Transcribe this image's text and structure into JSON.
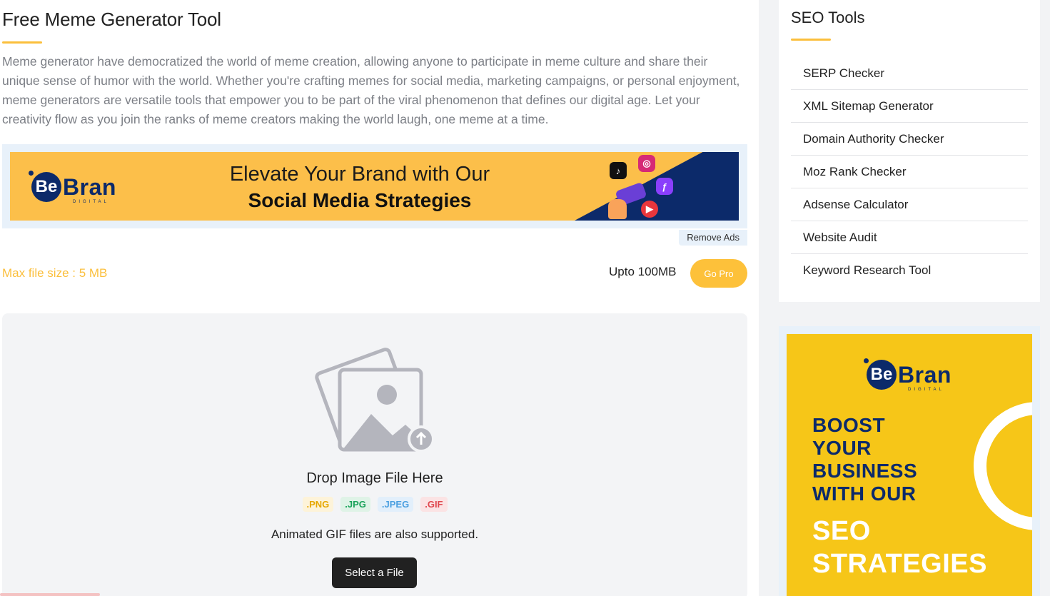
{
  "page": {
    "title": "Free Meme Generator Tool",
    "intro": "Meme generator have democratized the world of meme creation, allowing anyone to participate in meme culture and share their unique sense of humor with the world. Whether you're crafting memes for social media, marketing campaigns, or personal enjoyment, meme generators are versatile tools that empower you to be part of the viral phenomenon that defines our digital age. Let your creativity flow as you join the ranks of meme creators making the world laugh, one meme at a time."
  },
  "ad_banner": {
    "logo_be": "Be",
    "logo_bran": "Bran",
    "logo_digital": "DIGITAL",
    "headline": "Elevate Your Brand with Our",
    "subheadline": "Social Media Strategies",
    "remove_ads": "Remove Ads"
  },
  "limits": {
    "max_file": "Max file size : 5 MB",
    "upto": "Upto 100MB",
    "go_pro": "Go Pro"
  },
  "upload": {
    "drop_label": "Drop Image File Here",
    "formats": [
      ".PNG",
      ".JPG",
      ".JPEG",
      ".GIF"
    ],
    "animated_note": "Animated GIF files are also supported.",
    "select_button": "Select a File"
  },
  "sidebar": {
    "title": "SEO Tools",
    "items": [
      "SERP Checker",
      "XML Sitemap Generator",
      "Domain Authority Checker",
      "Moz Rank Checker",
      "Adsense Calculator",
      "Website Audit",
      "Keyword Research Tool"
    ]
  },
  "side_ad": {
    "logo_be": "Be",
    "logo_bran": "Bran",
    "logo_digital": "DIGITAL",
    "boost_lines": [
      "BOOST",
      "YOUR",
      "BUSINESS",
      "WITH OUR"
    ],
    "seo_lines": [
      "SEO",
      "STRATEGIES"
    ]
  },
  "colors": {
    "accent": "#fbbf3c",
    "brand_navy": "#0c2a6a",
    "png": "#e6a700",
    "jpg": "#1aa35a",
    "jpeg": "#4b9fe0",
    "gif": "#e0484f"
  }
}
